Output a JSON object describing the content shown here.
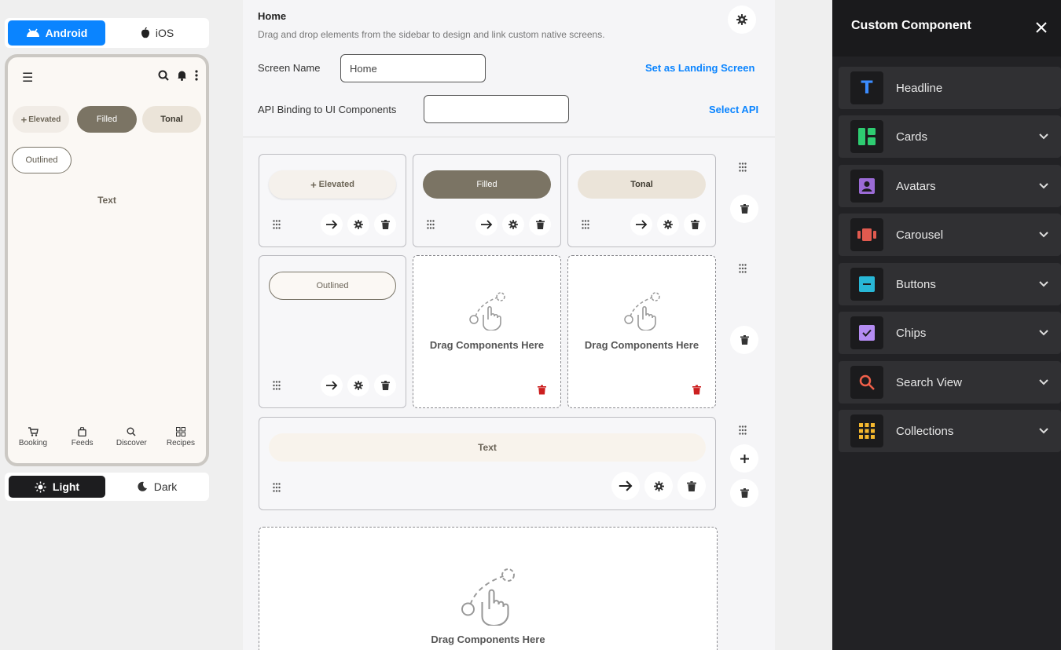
{
  "platform": {
    "android": "Android",
    "ios": "iOS"
  },
  "preview": {
    "chips": {
      "elevated": "Elevated",
      "filled": "Filled",
      "tonal": "Tonal",
      "outlined": "Outlined"
    },
    "text": "Text",
    "nav": [
      "Booking",
      "Feeds",
      "Discover",
      "Recipes"
    ]
  },
  "theme": {
    "light": "Light",
    "dark": "Dark"
  },
  "editor": {
    "title": "Home",
    "subtitle": "Drag and drop elements from the sidebar to design and link custom native screens.",
    "screen_name_label": "Screen Name",
    "screen_name_value": "Home",
    "landing_link": "Set as Landing Screen",
    "api_label": "API Binding to UI Components",
    "api_value": "",
    "api_link": "Select API",
    "cells": {
      "elevated": "Elevated",
      "filled": "Filled",
      "tonal": "Tonal",
      "outlined": "Outlined",
      "text": "Text"
    },
    "drop_label": "Drag Components Here"
  },
  "panel": {
    "title": "Custom Component",
    "items": [
      {
        "label": "Headline",
        "icon": "headline-icon",
        "color": "#3b8cff"
      },
      {
        "label": "Cards",
        "icon": "cards-icon",
        "color": "#2ecc71"
      },
      {
        "label": "Avatars",
        "icon": "avatar-icon",
        "color": "#9b6bd6"
      },
      {
        "label": "Carousel",
        "icon": "carousel-icon",
        "color": "#e05a4f"
      },
      {
        "label": "Buttons",
        "icon": "buttons-icon",
        "color": "#28b7d6"
      },
      {
        "label": "Chips",
        "icon": "chips-icon",
        "color": "#b48cf2"
      },
      {
        "label": "Search View",
        "icon": "search-icon",
        "color": "#f0604a"
      },
      {
        "label": "Collections",
        "icon": "grid-icon",
        "color": "#f5b82e"
      }
    ]
  },
  "colors": {
    "accent": "#0a84ff",
    "danger": "#cc1f1f",
    "panel_bg": "#222225"
  }
}
